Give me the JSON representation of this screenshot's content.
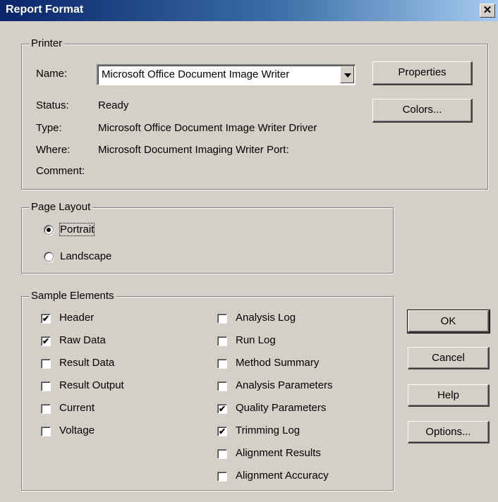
{
  "window": {
    "title": "Report Format",
    "close": "✕"
  },
  "printer": {
    "group_label": "Printer",
    "name_label": "Name:",
    "name_value": "Microsoft Office Document Image Writer",
    "status_label": "Status:",
    "status_value": "Ready",
    "type_label": "Type:",
    "type_value": "Microsoft Office Document Image Writer Driver",
    "where_label": "Where:",
    "where_value": "Microsoft Document Imaging Writer Port:",
    "comment_label": "Comment:",
    "comment_value": "",
    "properties_button": "Properties",
    "colors_button": "Colors..."
  },
  "page_layout": {
    "group_label": "Page Layout",
    "portrait": {
      "label": "Portrait",
      "selected": true
    },
    "landscape": {
      "label": "Landscape",
      "selected": false
    }
  },
  "sample_elements": {
    "group_label": "Sample Elements",
    "left": [
      {
        "label": "Header",
        "checked": true
      },
      {
        "label": "Raw Data",
        "checked": true
      },
      {
        "label": "Result Data",
        "checked": false
      },
      {
        "label": "Result Output",
        "checked": false
      },
      {
        "label": "Current",
        "checked": false
      },
      {
        "label": "Voltage",
        "checked": false
      }
    ],
    "right": [
      {
        "label": "Analysis Log",
        "checked": false
      },
      {
        "label": "Run Log",
        "checked": false
      },
      {
        "label": "Method Summary",
        "checked": false
      },
      {
        "label": "Analysis Parameters",
        "checked": false
      },
      {
        "label": "Quality Parameters",
        "checked": true
      },
      {
        "label": "Trimming Log",
        "checked": true
      },
      {
        "label": "Alignment Results",
        "checked": false
      },
      {
        "label": "Alignment Accuracy",
        "checked": false
      }
    ]
  },
  "buttons": {
    "ok": "OK",
    "cancel": "Cancel",
    "help": "Help",
    "options": "Options..."
  },
  "check_glyph": "✔"
}
